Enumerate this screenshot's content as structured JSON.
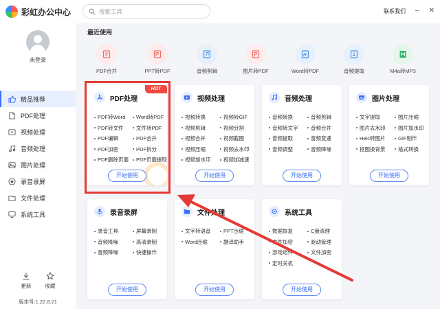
{
  "app": {
    "title": "彩虹办公中心"
  },
  "search": {
    "placeholder": "搜索工具"
  },
  "top_right": {
    "contact": "联系我们",
    "minimize": "–",
    "close": "✕"
  },
  "user": {
    "login_label": "未登录"
  },
  "sidebar": {
    "items": [
      {
        "label": "精品推荐",
        "icon": "thumbs-up-icon",
        "active": true
      },
      {
        "label": "PDF处理",
        "icon": "pdf-icon"
      },
      {
        "label": "视频处理",
        "icon": "video-icon"
      },
      {
        "label": "音频处理",
        "icon": "music-icon"
      },
      {
        "label": "图片处理",
        "icon": "image-icon"
      },
      {
        "label": "录音录屏",
        "icon": "record-icon"
      },
      {
        "label": "文件处理",
        "icon": "folder-icon"
      },
      {
        "label": "系统工具",
        "icon": "system-icon"
      }
    ],
    "update_label": "更新",
    "favorite_label": "收藏",
    "version": "版本号:1.22.8.21"
  },
  "recent": {
    "title": "最近使用",
    "items": [
      {
        "label": "PDF合并",
        "icon": "pdf-merge-icon",
        "color": "#f36b6b",
        "bg": "#fdeceb"
      },
      {
        "label": "PPT转PDF",
        "icon": "ppt-to-pdf-icon",
        "color": "#f36b6b",
        "bg": "#fdeceb"
      },
      {
        "label": "音频剪辑",
        "icon": "audio-cut-icon",
        "color": "#4a90e2",
        "bg": "#e7f1fc"
      },
      {
        "label": "图片转PDF",
        "icon": "image-to-pdf-icon",
        "color": "#f36b6b",
        "bg": "#fdeceb"
      },
      {
        "label": "Word转PDF",
        "icon": "word-to-pdf-icon",
        "color": "#4a90e2",
        "bg": "#e7f1fc"
      },
      {
        "label": "音频提取",
        "icon": "audio-extract-icon",
        "color": "#4a90e2",
        "bg": "#e7f1fc"
      },
      {
        "label": "M4a转MP3",
        "icon": "m4a-to-mp3-icon",
        "color": "#2fb36b",
        "bg": "#e5f6ec"
      }
    ]
  },
  "cards": [
    {
      "key": "pdf",
      "title": "PDF处理",
      "hot": "HOT",
      "icon": "pdf-icon",
      "color": "#3a6ff7",
      "features": [
        "PDF转Word",
        "Word转PDF",
        "PDF转文件",
        "文件转PDF",
        "PDF编辑",
        "PDF合并",
        "PDF加密",
        "PDF拆分",
        "PDF删除页面",
        "PDF页面提取"
      ],
      "button": "开始使用"
    },
    {
      "key": "video",
      "title": "视频处理",
      "icon": "video-icon",
      "color": "#3a6ff7",
      "features": [
        "视频转换",
        "视频转GIF",
        "视频剪辑",
        "视频分割",
        "视频合并",
        "视频截图",
        "视频压缩",
        "视频去水印",
        "视频加水印",
        "视频加减速"
      ],
      "button": "开始使用"
    },
    {
      "key": "audio",
      "title": "音频处理",
      "icon": "music-icon",
      "color": "#3a6ff7",
      "features": [
        "音频转换",
        "音频剪辑",
        "音频转文字",
        "音频合并",
        "音频提取",
        "音频变速",
        "音频调整",
        "音频降噪"
      ],
      "button": "开始使用"
    },
    {
      "key": "image",
      "title": "图片处理",
      "icon": "image-icon",
      "color": "#3a6ff7",
      "features": [
        "文字提取",
        "图片压缩",
        "图片去水印",
        "图片加水印",
        "Heic转图片",
        "GIF制作",
        "抠图换背景",
        "格式转换"
      ],
      "button": "开始使用"
    },
    {
      "key": "record",
      "title": "录音录屏",
      "icon": "record-icon",
      "color": "#3a6ff7",
      "features": [
        "录音工具",
        "屏幕录制",
        "音频降噪",
        "高清录制",
        "音频降噪",
        "快捷操作"
      ],
      "button": "开始使用"
    },
    {
      "key": "file",
      "title": "文件处理",
      "icon": "folder-icon",
      "color": "#3a6ff7",
      "features": [
        "文字转语音",
        "PPT压缩",
        "Word压缩",
        "翻译助手"
      ],
      "button": "开始使用"
    },
    {
      "key": "system",
      "title": "系统工具",
      "icon": "system-icon",
      "color": "#3a6ff7",
      "features": [
        "数据恢复",
        "C盘清理",
        "文件加密",
        "驱动管理",
        "游戏组件",
        "文件加密",
        "定时关机"
      ],
      "button": "开始使用"
    }
  ]
}
